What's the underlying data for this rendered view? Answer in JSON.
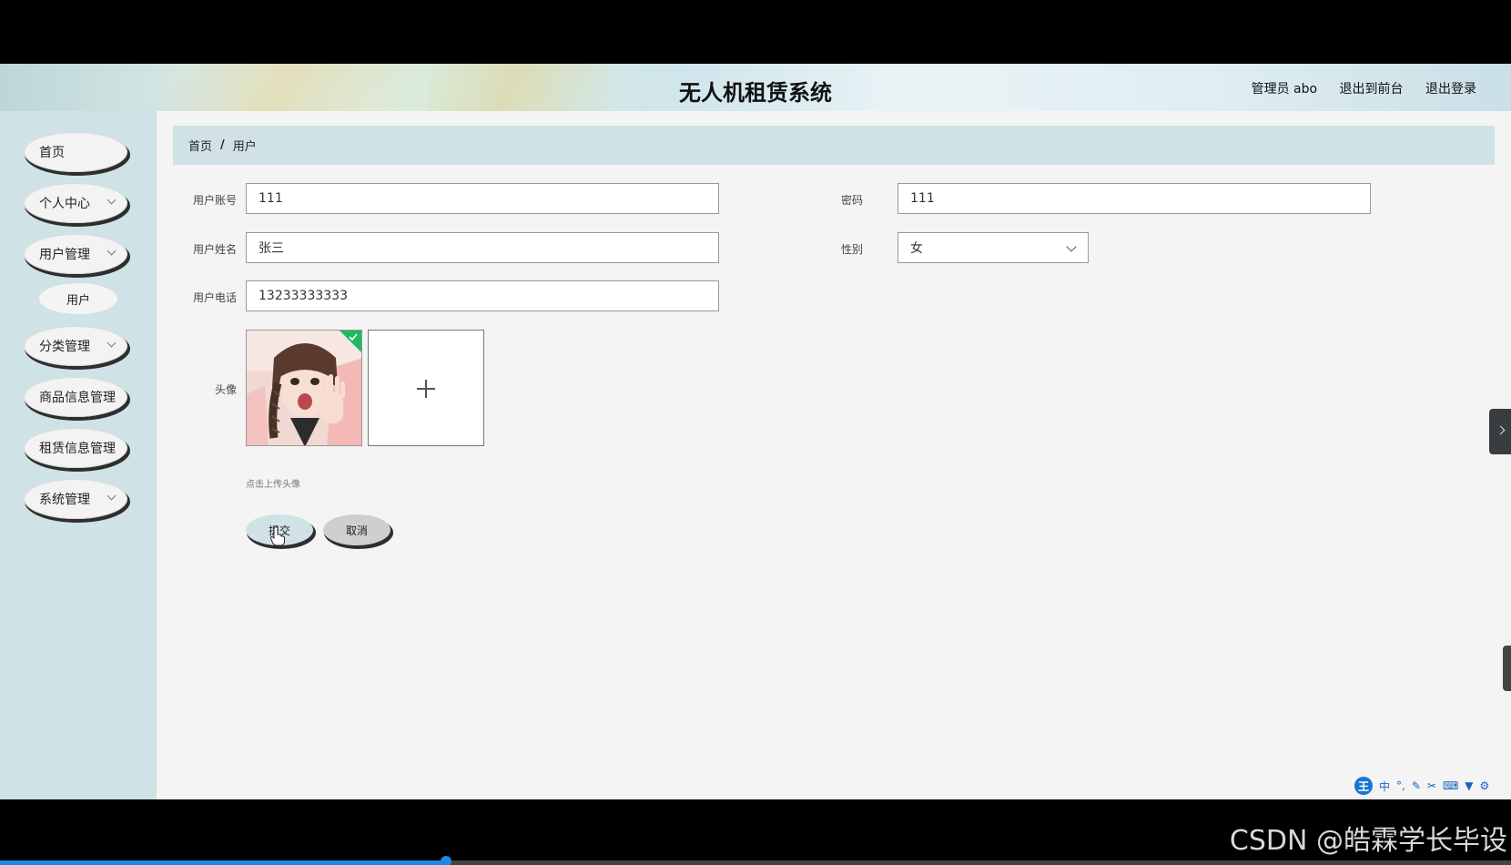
{
  "header": {
    "title": "无人机租赁系统",
    "user_label": "管理员 abo",
    "to_frontend": "退出到前台",
    "logout": "退出登录"
  },
  "sidebar": {
    "items": [
      {
        "label": "首页",
        "has_children": false
      },
      {
        "label": "个人中心",
        "has_children": true
      },
      {
        "label": "用户管理",
        "has_children": true,
        "expanded": true,
        "children": [
          "用户"
        ]
      },
      {
        "label": "分类管理",
        "has_children": true
      },
      {
        "label": "商品信息管理",
        "has_children": false
      },
      {
        "label": "租赁信息管理",
        "has_children": false
      },
      {
        "label": "系统管理",
        "has_children": true
      }
    ]
  },
  "breadcrumb": {
    "home": "首页",
    "separator": "/",
    "current": "用户"
  },
  "form": {
    "account": {
      "label": "用户账号",
      "value": "111"
    },
    "password": {
      "label": "密码",
      "value": "111"
    },
    "name": {
      "label": "用户姓名",
      "value": "张三"
    },
    "gender": {
      "label": "性别",
      "value": "女"
    },
    "phone": {
      "label": "用户电话",
      "value": "13233333333"
    },
    "avatar": {
      "label": "头像",
      "hint": "点击上传头像",
      "uploaded": true
    }
  },
  "buttons": {
    "submit": "提交",
    "cancel": "取消"
  },
  "ime": {
    "logo": "王",
    "mode": "中",
    "icons": [
      "punctuation-icon",
      "pen-icon",
      "scissors-icon",
      "keyboard-icon",
      "shirt-icon",
      "gear-icon"
    ]
  },
  "watermark": "CSDN @皓霖学长毕设",
  "video_progress": 0.295,
  "colors": {
    "accent": "#d0e2e5",
    "success": "#1fba5f",
    "progress": "#1e88e5"
  }
}
